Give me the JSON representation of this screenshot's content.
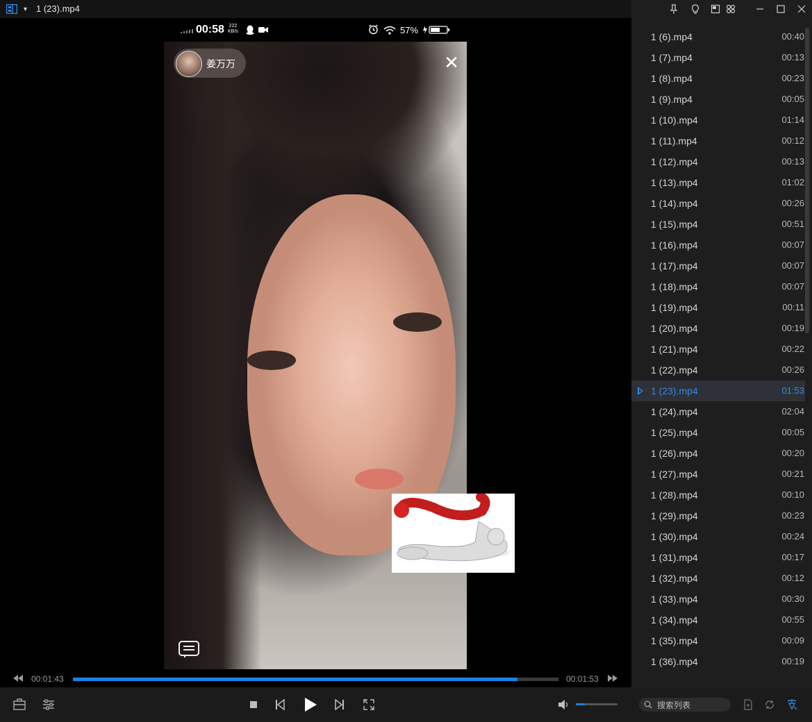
{
  "window": {
    "title": "1 (23).mp4"
  },
  "phone_status": {
    "time": "00:58",
    "speed_top": "222",
    "speed_bottom": "KB/s",
    "battery": "57%"
  },
  "video": {
    "caster_name": "姜万万"
  },
  "playback": {
    "elapsed": "00:01:43",
    "duration": "00:01:53",
    "progress_fraction": 0.915,
    "volume_fraction": 0.22
  },
  "playlist": {
    "items": [
      {
        "name": "1 (6).mp4",
        "duration": "00:40"
      },
      {
        "name": "1 (7).mp4",
        "duration": "00:13"
      },
      {
        "name": "1 (8).mp4",
        "duration": "00:23"
      },
      {
        "name": "1 (9).mp4",
        "duration": "00:05"
      },
      {
        "name": "1 (10).mp4",
        "duration": "01:14"
      },
      {
        "name": "1 (11).mp4",
        "duration": "00:12"
      },
      {
        "name": "1 (12).mp4",
        "duration": "00:13"
      },
      {
        "name": "1 (13).mp4",
        "duration": "01:02"
      },
      {
        "name": "1 (14).mp4",
        "duration": "00:26"
      },
      {
        "name": "1 (15).mp4",
        "duration": "00:51"
      },
      {
        "name": "1 (16).mp4",
        "duration": "00:07"
      },
      {
        "name": "1 (17).mp4",
        "duration": "00:07"
      },
      {
        "name": "1 (18).mp4",
        "duration": "00:07"
      },
      {
        "name": "1 (19).mp4",
        "duration": "00:11"
      },
      {
        "name": "1 (20).mp4",
        "duration": "00:19"
      },
      {
        "name": "1 (21).mp4",
        "duration": "00:22"
      },
      {
        "name": "1 (22).mp4",
        "duration": "00:26"
      },
      {
        "name": "1 (23).mp4",
        "duration": "01:53",
        "active": true
      },
      {
        "name": "1 (24).mp4",
        "duration": "02:04"
      },
      {
        "name": "1 (25).mp4",
        "duration": "00:05"
      },
      {
        "name": "1 (26).mp4",
        "duration": "00:20"
      },
      {
        "name": "1 (27).mp4",
        "duration": "00:21"
      },
      {
        "name": "1 (28).mp4",
        "duration": "00:10"
      },
      {
        "name": "1 (29).mp4",
        "duration": "00:23"
      },
      {
        "name": "1 (30).mp4",
        "duration": "00:24"
      },
      {
        "name": "1 (31).mp4",
        "duration": "00:17"
      },
      {
        "name": "1 (32).mp4",
        "duration": "00:12"
      },
      {
        "name": "1 (33).mp4",
        "duration": "00:30"
      },
      {
        "name": "1 (34).mp4",
        "duration": "00:55"
      },
      {
        "name": "1 (35).mp4",
        "duration": "00:09"
      },
      {
        "name": "1 (36).mp4",
        "duration": "00:19"
      }
    ],
    "search_placeholder": "搜索列表"
  },
  "colors": {
    "accent": "#1a82e6",
    "active_text": "#2f8bea",
    "playlist_bg": "#1e1e1e"
  },
  "icons": {
    "app": "app-logo-icon",
    "pin": "pin-icon",
    "skin": "skin-icon",
    "minimize": "minimize-icon",
    "maximize": "maximize-icon",
    "close": "close-icon"
  }
}
